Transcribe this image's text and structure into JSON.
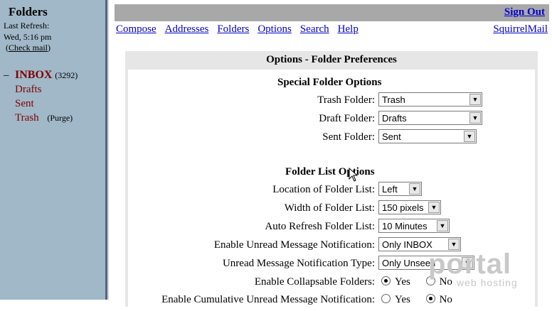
{
  "sidebar": {
    "title": "Folders",
    "last_refresh_label": "Last Refresh:",
    "last_refresh_time": "Wed, 5:16 pm",
    "check_mail": "Check mail",
    "collapse_marker": "–",
    "folders": [
      {
        "label": "INBOX",
        "count": "(3292)"
      },
      {
        "label": "Drafts"
      },
      {
        "label": "Sent"
      },
      {
        "label": "Trash",
        "purge": "(Purge)"
      }
    ]
  },
  "header": {
    "sign_out": "Sign Out",
    "nav": [
      "Compose",
      "Addresses",
      "Folders",
      "Options",
      "Search",
      "Help"
    ],
    "brand_link": "SquirrelMail"
  },
  "panel": {
    "title": "Options - Folder Preferences",
    "special_title": "Special Folder Options",
    "special": [
      {
        "label": "Trash Folder:",
        "value": "Trash"
      },
      {
        "label": "Draft Folder:",
        "value": "Drafts"
      },
      {
        "label": "Sent Folder:",
        "value": "Sent"
      }
    ],
    "list_title": "Folder List Options",
    "list": [
      {
        "label": "Location of Folder List:",
        "value": "Left"
      },
      {
        "label": "Width of Folder List:",
        "value": "150 pixels"
      },
      {
        "label": "Auto Refresh Folder List:",
        "value": "10 Minutes"
      },
      {
        "label": "Enable Unread Message Notification:",
        "value": "Only INBOX"
      },
      {
        "label": "Unread Message Notification Type:",
        "value": "Only Unseen"
      }
    ],
    "collapsable": {
      "label": "Enable Collapsable Folders:",
      "yes": "Yes",
      "no": "No"
    },
    "cumulative": {
      "label": "Enable Cumulative Unread Message Notification:",
      "yes": "Yes",
      "no": "No"
    }
  },
  "watermark": {
    "line1": "portal",
    "line2": "web hosting"
  }
}
